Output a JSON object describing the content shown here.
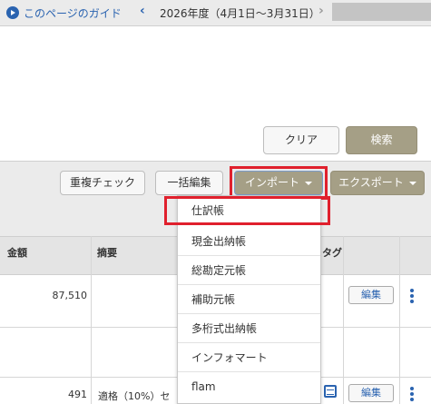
{
  "topbar": {
    "guide_link": "このページのガイド",
    "period": "2026年度（4月1日〜3月31日）",
    "prev_icon": "chevron-left-icon",
    "next_icon": "chevron-right-icon"
  },
  "search": {
    "clear_label": "クリア",
    "search_label": "検索"
  },
  "actions": {
    "duplicate_check": "重複チェック",
    "bulk_edit": "一括編集",
    "import": "インポート",
    "export": "エクスポート"
  },
  "import_menu": {
    "items": [
      "仕訳帳",
      "現金出納帳",
      "総勘定元帳",
      "補助元帳",
      "多桁式出納帳",
      "インフォマート",
      "flam"
    ],
    "highlighted": "仕訳帳"
  },
  "table": {
    "headers": {
      "amount": "金額",
      "memo": "摘要",
      "tag": "タグ"
    },
    "rows": [
      {
        "amount": "87,510",
        "memo": "",
        "edit": "編集"
      },
      {
        "amount": "491",
        "memo": "適格（10%）セ",
        "edit": "編集"
      }
    ]
  },
  "colors": {
    "link_blue": "#2a63b0",
    "primary_button": "#a59f86",
    "highlight_red": "#e0202d"
  }
}
